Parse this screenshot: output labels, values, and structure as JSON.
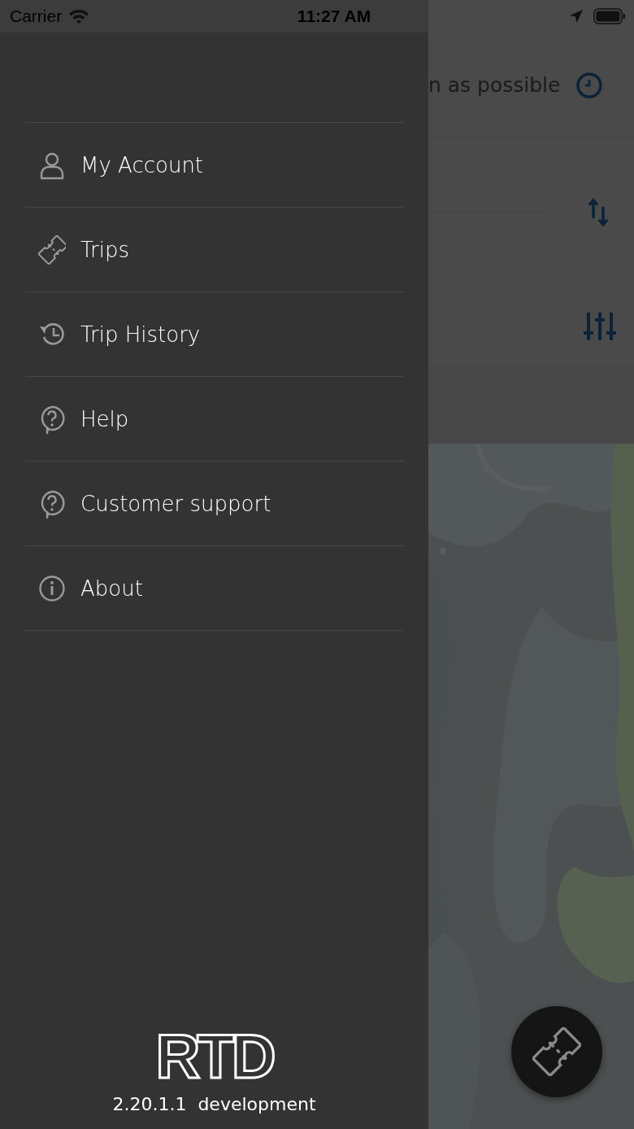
{
  "status_bar": {
    "carrier": "Carrier",
    "time": "11:27 AM"
  },
  "menu": {
    "items": [
      {
        "label": "My Account",
        "kind": "account"
      },
      {
        "label": "Trips",
        "kind": "ticket"
      },
      {
        "label": "Trip History",
        "kind": "history"
      },
      {
        "label": "Help",
        "kind": "help"
      },
      {
        "label": "Customer support",
        "kind": "help"
      },
      {
        "label": "About",
        "kind": "info"
      }
    ]
  },
  "footer": {
    "logo": "RTD",
    "version": "2.20.1.1  development"
  },
  "background_screen": {
    "departure_label": "n as possible"
  }
}
